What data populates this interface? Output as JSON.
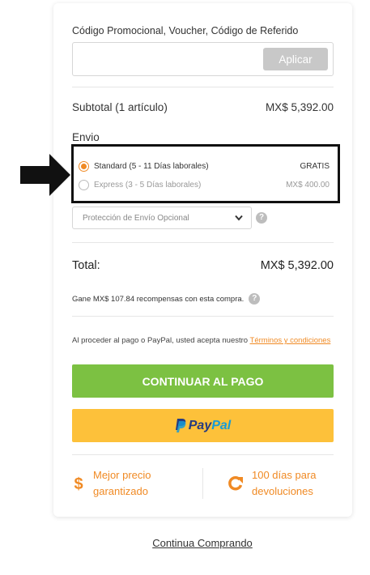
{
  "promo": {
    "label": "Código Promocional, Voucher, Código de Referido",
    "input_value": "",
    "apply_label": "Aplicar"
  },
  "summary": {
    "subtotal_label": "Subtotal (1 artículo)",
    "subtotal_value": "MX$ 5,392.00",
    "shipping_label": "Envio",
    "options": [
      {
        "label": "Standard (5 - 11 Días laborales)",
        "price": "GRATIS",
        "selected": true
      },
      {
        "label": "Express (3 - 5 Días laborales)",
        "price": "MX$ 400.00",
        "selected": false
      }
    ],
    "protection_placeholder": "Protección de Envío Opcional",
    "total_label": "Total:",
    "total_value": "MX$ 5,392.00",
    "rewards_text": "Gane  MX$ 107.84  recompensas con esta compra."
  },
  "legal": {
    "text": "Al proceder al pago o PayPal, usted acepta nuestro ",
    "link": "Términos y condiciones"
  },
  "buttons": {
    "checkout": "CONTINUAR AL PAGO",
    "paypal_pay": "Pay",
    "paypal_pal": "Pal"
  },
  "benefits": [
    {
      "icon": "dollar-icon",
      "line1": "Mejor precio",
      "line2": "garantizado"
    },
    {
      "icon": "return-icon",
      "line1": "100 días para",
      "line2": "devoluciones"
    }
  ],
  "continue_link": "Continua Comprando",
  "colors": {
    "accent": "#f08a24",
    "checkout_green": "#7cc142",
    "paypal_yellow": "#fdc13a",
    "paypal_blue_dark": "#253b80",
    "paypal_blue_light": "#179bd7"
  }
}
